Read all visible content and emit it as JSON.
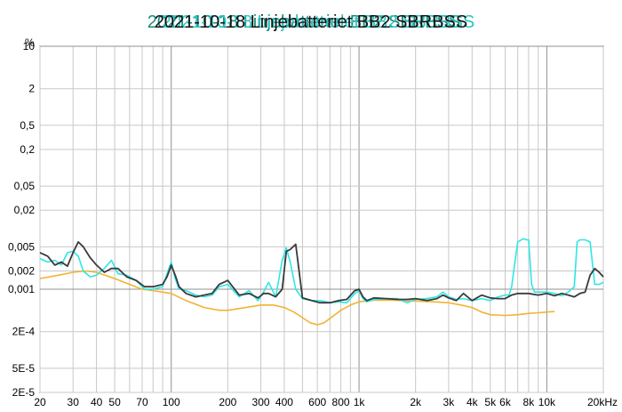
{
  "chart_data": {
    "type": "line",
    "title": "2021-10-18 Linjebatteriet BB2 SBRBSS",
    "title_overlaps": [
      "2021-10-18 Linjebatteriet BB2 SBRBSS",
      "2021-10-18 Linjebatteriet BB2 SBRBSS",
      "2021-10-18 Linjebatteriet BB2 SBRBSS"
    ],
    "ylabel": "%",
    "xlabel": "Hz",
    "x_scale": "log",
    "y_scale": "log",
    "xlim": [
      20,
      20000
    ],
    "ylim": [
      2e-05,
      10
    ],
    "grid": true,
    "colors": {
      "cyan": "#2ee6e6",
      "dark": "#3a3a3a",
      "orange": "#f0b432",
      "grid": "#c8c8c8",
      "major_grid": "#909090"
    },
    "x_ticks": [
      {
        "v": 20,
        "label": "20"
      },
      {
        "v": 30,
        "label": "30"
      },
      {
        "v": 40,
        "label": "40"
      },
      {
        "v": 50,
        "label": "50"
      },
      {
        "v": 70,
        "label": "70"
      },
      {
        "v": 100,
        "label": "100"
      },
      {
        "v": 200,
        "label": "200"
      },
      {
        "v": 300,
        "label": "300"
      },
      {
        "v": 400,
        "label": "400"
      },
      {
        "v": 600,
        "label": "600"
      },
      {
        "v": 800,
        "label": "800"
      },
      {
        "v": 1000,
        "label": "1k"
      },
      {
        "v": 2000,
        "label": "2k"
      },
      {
        "v": 3000,
        "label": "3k"
      },
      {
        "v": 4000,
        "label": "4k"
      },
      {
        "v": 5000,
        "label": "5k"
      },
      {
        "v": 6000,
        "label": "6k"
      },
      {
        "v": 8000,
        "label": "8k"
      },
      {
        "v": 10000,
        "label": "10k"
      },
      {
        "v": 20000,
        "label": "20kHz"
      }
    ],
    "y_ticks": [
      {
        "v": 10,
        "label": "10"
      },
      {
        "v": 2,
        "label": "2"
      },
      {
        "v": 0.5,
        "label": "0,5"
      },
      {
        "v": 0.2,
        "label": "0,2"
      },
      {
        "v": 0.05,
        "label": "0,05"
      },
      {
        "v": 0.02,
        "label": "0,02"
      },
      {
        "v": 0.005,
        "label": "0,005"
      },
      {
        "v": 0.002,
        "label": "0,002"
      },
      {
        "v": 0.001,
        "label": "0,001"
      },
      {
        "v": 0.0002,
        "label": "2E-4"
      },
      {
        "v": 5e-05,
        "label": "5E-5"
      },
      {
        "v": 2e-05,
        "label": "2E-5"
      }
    ],
    "series": [
      {
        "color": "#f0b432",
        "x": [
          20,
          25,
          30,
          35,
          40,
          50,
          60,
          70,
          80,
          100,
          120,
          150,
          180,
          200,
          250,
          300,
          350,
          400,
          450,
          500,
          550,
          600,
          650,
          700,
          800,
          900,
          1000,
          1200,
          1500,
          2000,
          2500,
          3000,
          3500,
          4000,
          4500,
          5000,
          6000,
          7000,
          8000,
          9000,
          10000,
          11000
        ],
        "y": [
          0.0015,
          0.0017,
          0.0019,
          0.002,
          0.0019,
          0.0015,
          0.0012,
          0.001,
          0.00095,
          0.00085,
          0.00065,
          0.0005,
          0.00045,
          0.00045,
          0.0005,
          0.00055,
          0.00055,
          0.0005,
          0.00042,
          0.00034,
          0.00028,
          0.00026,
          0.00028,
          0.00033,
          0.00045,
          0.00055,
          0.00062,
          0.00066,
          0.00066,
          0.00064,
          0.00062,
          0.0006,
          0.00055,
          0.0005,
          0.00042,
          0.00038,
          0.00037,
          0.00038,
          0.0004,
          0.00041,
          0.00042,
          0.00043
        ]
      },
      {
        "color": "#2ee6e6",
        "x": [
          20,
          22,
          24,
          26,
          28,
          30,
          32,
          34,
          37,
          40,
          44,
          48,
          52,
          58,
          65,
          72,
          80,
          90,
          95,
          100,
          105,
          110,
          120,
          135,
          150,
          165,
          180,
          200,
          230,
          260,
          290,
          310,
          330,
          360,
          390,
          410,
          430,
          460,
          500,
          560,
          620,
          700,
          780,
          860,
          950,
          1000,
          1050,
          1100,
          1200,
          1400,
          1600,
          1800,
          2000,
          2300,
          2600,
          2800,
          3000,
          3300,
          3600,
          4000,
          4500,
          5000,
          5500,
          6000,
          6300,
          6500,
          7000,
          7500,
          7800,
          8000,
          8300,
          8600,
          9000,
          10000,
          11000,
          12000,
          13000,
          14000,
          14500,
          15000,
          16000,
          17000,
          18000,
          19000,
          20000
        ],
        "y": [
          0.0032,
          0.0028,
          0.003,
          0.0025,
          0.004,
          0.0042,
          0.0035,
          0.002,
          0.0016,
          0.0017,
          0.0022,
          0.003,
          0.0018,
          0.0017,
          0.0014,
          0.001,
          0.001,
          0.0011,
          0.0018,
          0.0028,
          0.0015,
          0.001,
          0.00095,
          0.0008,
          0.00075,
          0.0008,
          0.0011,
          0.0012,
          0.00075,
          0.00095,
          0.00065,
          0.0009,
          0.0013,
          0.00075,
          0.003,
          0.0048,
          0.0028,
          0.001,
          0.0007,
          0.00065,
          0.00065,
          0.0006,
          0.00062,
          0.0006,
          0.00085,
          0.00095,
          0.0007,
          0.00062,
          0.00068,
          0.0007,
          0.0007,
          0.0006,
          0.00068,
          0.0007,
          0.00075,
          0.0009,
          0.00075,
          0.00068,
          0.0007,
          0.00065,
          0.0007,
          0.00065,
          0.00075,
          0.0008,
          0.0008,
          0.0011,
          0.006,
          0.0068,
          0.0065,
          0.0065,
          0.0012,
          0.0009,
          0.0009,
          0.0009,
          0.00085,
          0.00078,
          0.0009,
          0.0011,
          0.006,
          0.0065,
          0.0065,
          0.006,
          0.0012,
          0.0012,
          0.0013
        ]
      },
      {
        "color": "#3a3a3a",
        "x": [
          20,
          22,
          24,
          26,
          28,
          30,
          32,
          34,
          37,
          40,
          44,
          48,
          52,
          58,
          65,
          72,
          80,
          90,
          95,
          100,
          105,
          110,
          120,
          135,
          150,
          165,
          180,
          200,
          230,
          260,
          290,
          310,
          330,
          360,
          390,
          410,
          430,
          460,
          500,
          560,
          620,
          700,
          780,
          860,
          950,
          1000,
          1050,
          1100,
          1200,
          1400,
          1600,
          1800,
          2000,
          2300,
          2600,
          2800,
          3000,
          3300,
          3600,
          4000,
          4500,
          5000,
          5500,
          6000,
          6500,
          7000,
          8000,
          9000,
          10000,
          11000,
          12000,
          13000,
          14000,
          15000,
          16000,
          17000,
          18000,
          19000,
          20000
        ],
        "y": [
          0.004,
          0.0035,
          0.0025,
          0.0028,
          0.0024,
          0.004,
          0.006,
          0.005,
          0.0033,
          0.0025,
          0.0019,
          0.0022,
          0.0022,
          0.0016,
          0.0014,
          0.0011,
          0.0011,
          0.0012,
          0.0016,
          0.0025,
          0.0017,
          0.0011,
          0.00085,
          0.00075,
          0.0008,
          0.00085,
          0.0012,
          0.0014,
          0.0008,
          0.00085,
          0.00072,
          0.00085,
          0.00085,
          0.00075,
          0.001,
          0.0042,
          0.0045,
          0.0055,
          0.00072,
          0.00065,
          0.0006,
          0.0006,
          0.00065,
          0.00068,
          0.00095,
          0.001,
          0.00075,
          0.00065,
          0.00072,
          0.0007,
          0.00068,
          0.00068,
          0.0007,
          0.00065,
          0.0007,
          0.0008,
          0.00072,
          0.00065,
          0.00085,
          0.00065,
          0.0008,
          0.00072,
          0.0007,
          0.0007,
          0.0008,
          0.00085,
          0.00085,
          0.0008,
          0.00085,
          0.00078,
          0.00085,
          0.0008,
          0.00075,
          0.00085,
          0.0009,
          0.0017,
          0.0022,
          0.0019,
          0.0016
        ]
      }
    ]
  }
}
